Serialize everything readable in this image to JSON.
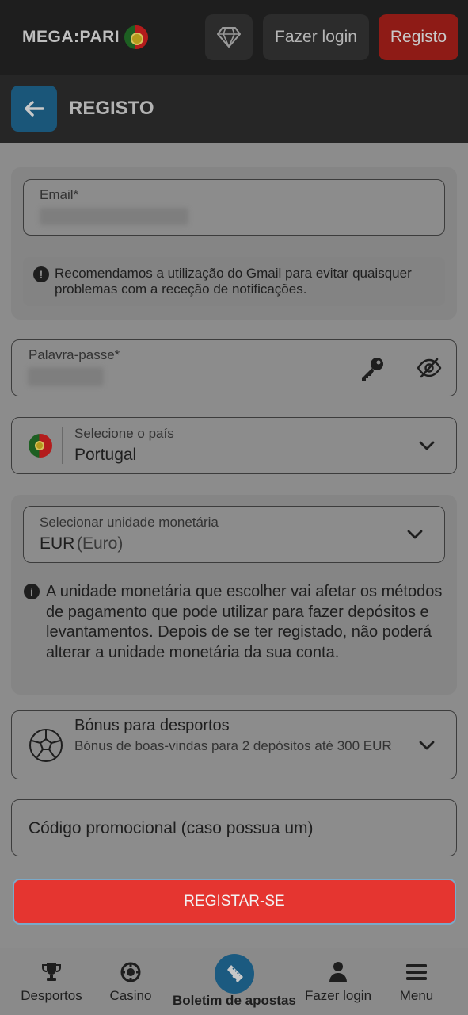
{
  "header": {
    "logo_text": "MEGA:PARI",
    "login_label": "Fazer login",
    "register_label": "Registo"
  },
  "subheader": {
    "title": "REGISTO"
  },
  "form": {
    "email": {
      "label": "Email*",
      "note": "Recomendamos a utilização do Gmail para evitar quaisquer problemas com a receção de notificações."
    },
    "password": {
      "label": "Palavra-passe*"
    },
    "country": {
      "label": "Selecione o país",
      "value": "Portugal"
    },
    "currency": {
      "label": "Selecionar unidade monetária",
      "code": "EUR",
      "name": "(Euro)",
      "note": "A unidade monetária que escolher vai afetar os métodos de pagamento que pode utilizar para fazer depósitos e levantamentos. Depois de se ter registado, não poderá alterar a unidade monetária da sua conta."
    },
    "bonus": {
      "title": "Bónus para desportos",
      "description": "Bónus de boas-vindas para 2 depósitos até 300 EUR"
    },
    "promo": {
      "placeholder": "Código promocional (caso possua um)"
    },
    "submit_label": "REGISTAR-SE"
  },
  "bottom_nav": {
    "sports": "Desportos",
    "casino": "Casino",
    "betslip": "Boletim de apostas",
    "login": "Fazer login",
    "menu": "Menu"
  },
  "colors": {
    "accent_red": "#e53530",
    "accent_blue": "#1b5a80"
  },
  "icons": [
    "diamond-icon",
    "back-arrow-icon",
    "key-icon",
    "eye-off-icon",
    "chevron-down-icon",
    "soccer-ball-icon",
    "trophy-icon",
    "casino-chip-icon",
    "ticket-icon",
    "user-icon",
    "menu-icon"
  ]
}
